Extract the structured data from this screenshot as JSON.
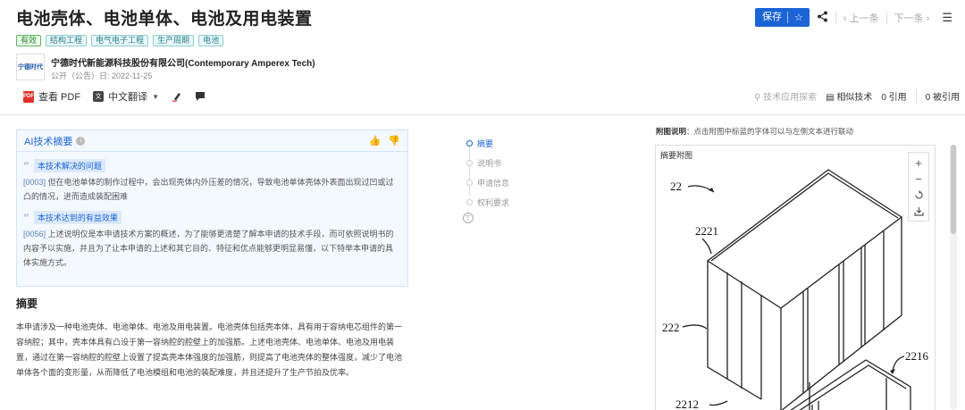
{
  "patent": {
    "title": "电池壳体、电池单体、电池及用电装置",
    "tags": [
      "有效",
      "结构工程",
      "电气电子工程",
      "生产周期",
      "电池"
    ],
    "company_logo_text": "宁德时代",
    "company": "宁德时代新能源科技股份有限公司(Contemporary Amperex Tech)",
    "pub_date": "公开（公告）日: 2022-11-25"
  },
  "header_actions": {
    "save_label": "保存",
    "save_icon": "star-icon",
    "prev": "上一条",
    "next": "下一条"
  },
  "toolbar": {
    "pdf_label": "查看 PDF",
    "translate_label": "中文翻译",
    "tech_explore": "技术应用探索",
    "similar": "相似技术",
    "cited": "0 引用",
    "cited_by": "0 被引用"
  },
  "ai_summary": {
    "title": "AI技术摘要",
    "problem_label": "本技术解决的问题",
    "problem_ref": "[0003]",
    "problem_text": "但在电池单体的制作过程中，会出现壳体内外压差的情况，导致电池单体壳体外表面出现过凹或过凸的情况，进而造成装配困难",
    "effect_label": "本技术达到的有益效果",
    "effect_ref": "[0056]",
    "effect_text": "上述说明仅是本申请技术方案的概述，为了能够更清楚了解本申请的技术手段，而可依照说明书的内容予以实施，并且为了让本申请的上述和其它目的、特征和优点能够更明显易懂，以下特举本申请的具体实施方式。"
  },
  "abstract": {
    "title": "摘要",
    "text": "本申请涉及一种电池壳体、电池单体、电池及用电装置。电池壳体包括壳本体，具有用于容纳电芯组件的第一容纳腔；其中，壳本体具有凸设于第一容纳腔的腔壁上的加强筋。上述电池壳体、电池单体、电池及用电装置，通过在第一容纳腔的腔壁上设置了提高壳本体强度的加强筋，则提高了电池壳体的整体强度，减少了电池单体各个面的变形量，从而降低了电池模组和电池的装配难度，并且还提升了生产节拍及优率。"
  },
  "toc": {
    "items": [
      "摘要",
      "说明书",
      "申请信息",
      "权利要求"
    ],
    "active_index": 0
  },
  "figure": {
    "desc_bold": "附图说明",
    "desc_text": "：点击附图中标蓝的字体可以与左侧文本进行联动",
    "label": "摘要附图",
    "ref_labels": [
      "22",
      "2221",
      "222",
      "2216",
      "2212"
    ]
  },
  "colors": {
    "accent": "#1c64d6",
    "tag_border": "#8fd0d0",
    "ai_bg": "#f4f9ff"
  }
}
